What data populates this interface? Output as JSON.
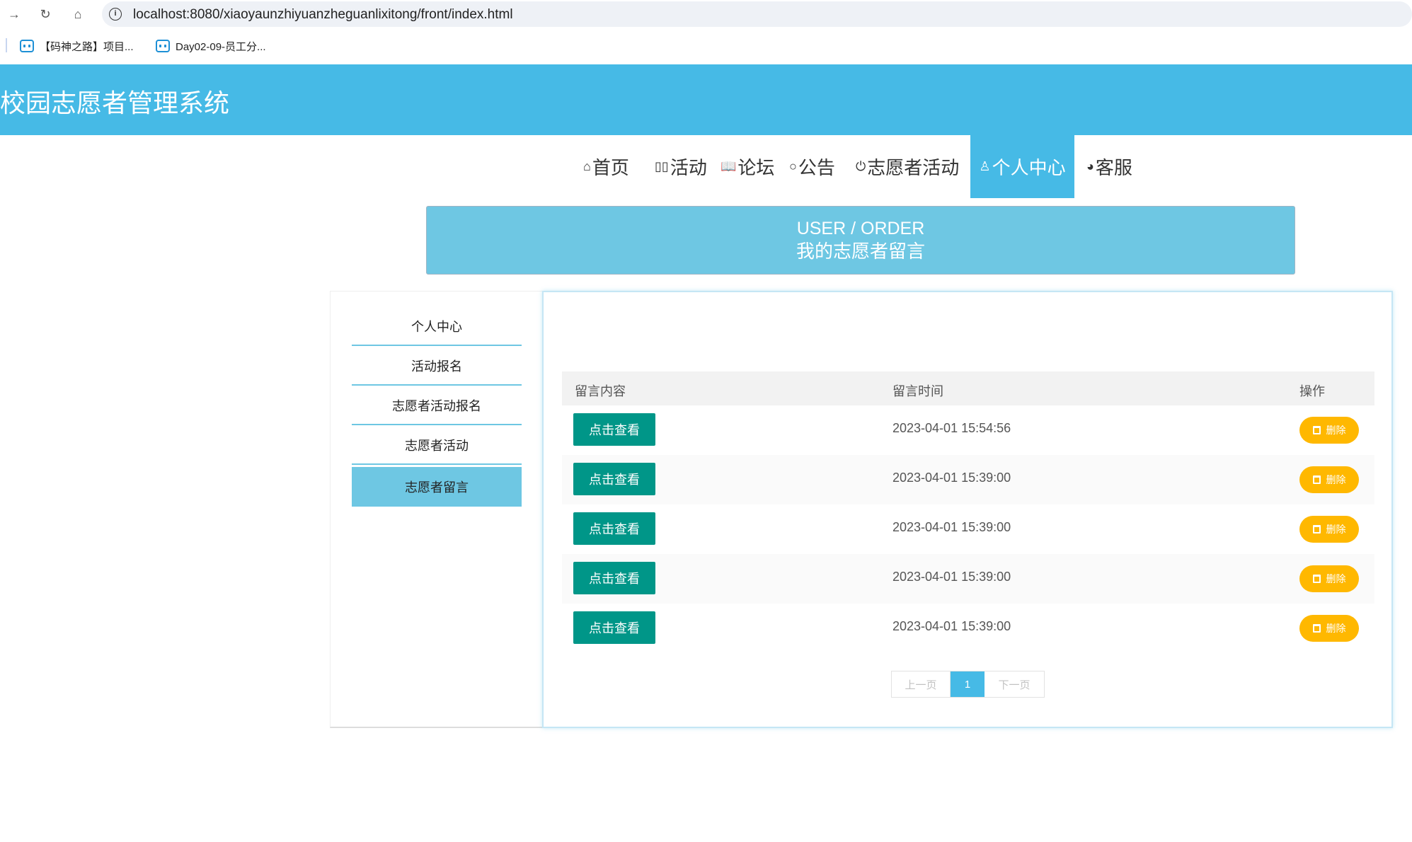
{
  "browser": {
    "url": "localhost:8080/xiaoyaunzhiyuanzheguanlixitong/front/index.html",
    "bookmarks": [
      {
        "label": "【码神之路】项目..."
      },
      {
        "label": "Day02-09-员工分..."
      }
    ]
  },
  "header": {
    "title": "校园志愿者管理系统"
  },
  "nav": {
    "items": [
      {
        "icon": "⌂",
        "label": "首页"
      },
      {
        "icon": "▯▯",
        "label": "活动"
      },
      {
        "icon": "📖",
        "label": "论坛"
      },
      {
        "icon": "○",
        "label": "公告"
      },
      {
        "icon": "⏻",
        "label": "志愿者活动"
      },
      {
        "icon": "♙",
        "label": "个人中心"
      },
      {
        "icon": "◕",
        "label": "客服"
      }
    ],
    "active": "个人中心"
  },
  "banner": {
    "en": "USER / ORDER",
    "cn": "我的志愿者留言"
  },
  "sidebar": {
    "items": [
      {
        "label": "个人中心"
      },
      {
        "label": "活动报名"
      },
      {
        "label": "志愿者活动报名"
      },
      {
        "label": "志愿者活动"
      },
      {
        "label": "志愿者留言"
      }
    ],
    "active": "志愿者留言"
  },
  "table": {
    "headers": [
      "留言内容",
      "留言时间",
      "操作"
    ],
    "rows": [
      {
        "view_label": "点击查看",
        "time": "2023-04-01 15:54:56",
        "delete_label": "删除"
      },
      {
        "view_label": "点击查看",
        "time": "2023-04-01 15:39:00",
        "delete_label": "删除"
      },
      {
        "view_label": "点击查看",
        "time": "2023-04-01 15:39:00",
        "delete_label": "删除"
      },
      {
        "view_label": "点击查看",
        "time": "2023-04-01 15:39:00",
        "delete_label": "删除"
      },
      {
        "view_label": "点击查看",
        "time": "2023-04-01 15:39:00",
        "delete_label": "删除"
      }
    ]
  },
  "pagination": {
    "prev": "上一页",
    "current": "1",
    "next": "下一页"
  },
  "colors": {
    "primary": "#46bae6",
    "banner": "#6ec7e3",
    "view_button": "#009688",
    "delete_button": "#ffb800"
  }
}
